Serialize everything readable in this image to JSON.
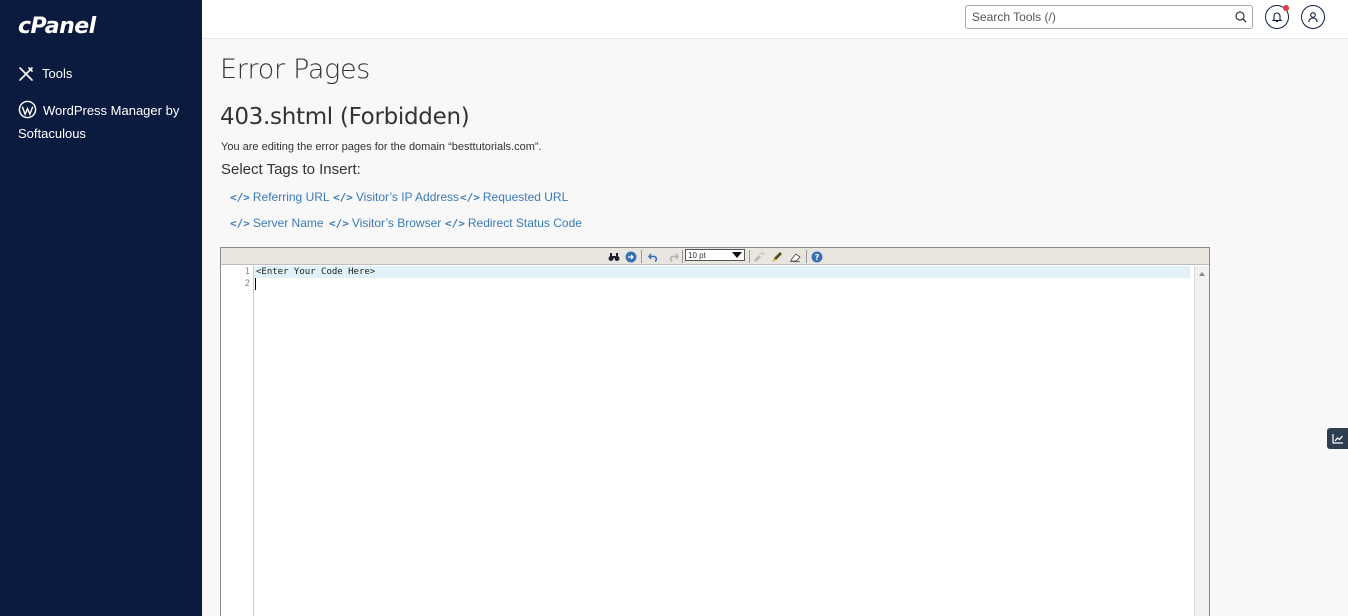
{
  "sidebar": {
    "logo": "cPanel",
    "items": [
      {
        "label": "Tools",
        "icon": "tools-icon"
      },
      {
        "label": "WordPress Manager by Softaculous",
        "icon": "wordpress-icon"
      }
    ]
  },
  "header": {
    "search_placeholder": "Search Tools (/)"
  },
  "main": {
    "page_title": "Error Pages",
    "sub_title": "403.shtml (Forbidden)",
    "description": "You are editing the error pages for the domain “besttutorials.com”.",
    "select_label": "Select Tags to Insert:",
    "tags": [
      "Referring URL",
      "Visitor’s IP Address",
      "Requested URL",
      "Server Name",
      "Visitor’s Browser",
      "Redirect Status Code"
    ]
  },
  "editor": {
    "font_size": "10 pt",
    "lines": [
      "<Enter Your Code Here>",
      ""
    ],
    "line_numbers": [
      "1",
      "2"
    ]
  },
  "colors": {
    "sidebar_bg": "#0b1b3f",
    "link": "#3a7ab8",
    "notification": "#e63946"
  }
}
